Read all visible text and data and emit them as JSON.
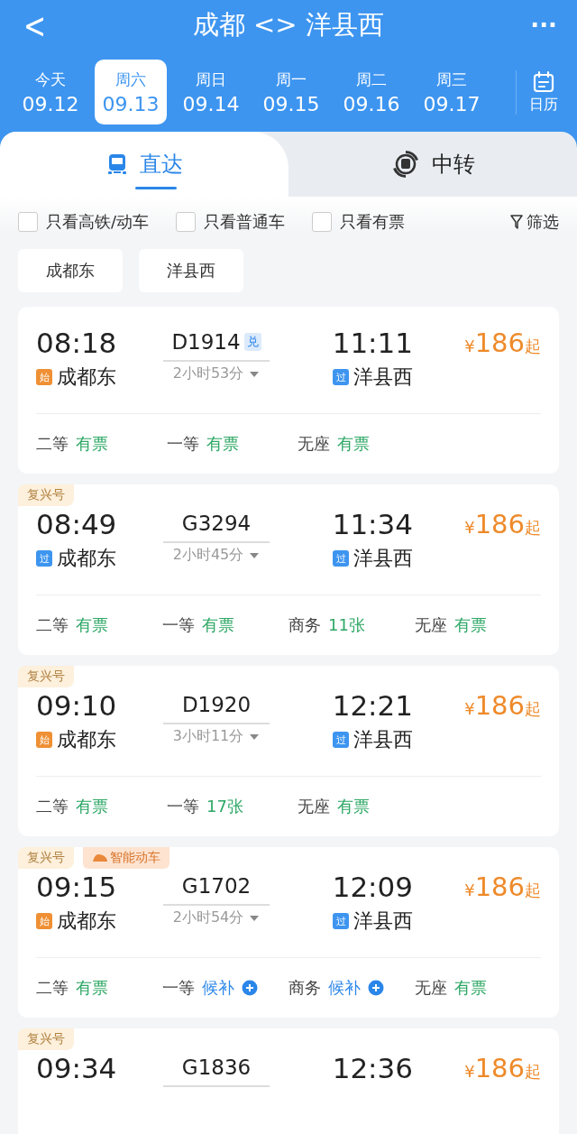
{
  "header": {
    "back": "<",
    "title": "成都 <> 洋县西",
    "more": "···"
  },
  "dates": [
    {
      "day": "今天",
      "date": "09.12",
      "selected": false
    },
    {
      "day": "周六",
      "date": "09.13",
      "selected": true
    },
    {
      "day": "周日",
      "date": "09.14",
      "selected": false
    },
    {
      "day": "周一",
      "date": "09.15",
      "selected": false
    },
    {
      "day": "周二",
      "date": "09.16",
      "selected": false
    },
    {
      "day": "周三",
      "date": "09.17",
      "selected": false
    }
  ],
  "calendar": {
    "label": "日历"
  },
  "tabs": [
    {
      "label": "直达",
      "selected": true
    },
    {
      "label": "中转",
      "selected": false
    }
  ],
  "filters": [
    {
      "label": "只看高铁/动车",
      "checked": false
    },
    {
      "label": "只看普通车",
      "checked": false
    },
    {
      "label": "只看有票",
      "checked": false
    }
  ],
  "filter_button": "筛选",
  "stations": [
    "成都东",
    "洋县西"
  ],
  "trains": [
    {
      "depart": "08:18",
      "train": "D1914",
      "exchange": "兑",
      "arrive": "11:11",
      "from_mark": {
        "text": "始",
        "kind": "start"
      },
      "from": "成都东",
      "duration": "2小时53分",
      "to_mark": {
        "text": "过",
        "kind": "pass"
      },
      "to": "洋县西",
      "price_symbol": "¥",
      "price": "186",
      "price_suffix": "起",
      "seats": [
        {
          "class": "二等",
          "status": "有票",
          "kind": "available"
        },
        {
          "class": "一等",
          "status": "有票",
          "kind": "available"
        },
        {
          "class": "无座",
          "status": "有票",
          "kind": "available"
        }
      ]
    },
    {
      "tags": [
        {
          "text": "复兴号",
          "kind": "plain"
        }
      ],
      "depart": "08:49",
      "train": "G3294",
      "arrive": "11:34",
      "from_mark": {
        "text": "过",
        "kind": "pass"
      },
      "from": "成都东",
      "duration": "2小时45分",
      "to_mark": {
        "text": "过",
        "kind": "pass"
      },
      "to": "洋县西",
      "price_symbol": "¥",
      "price": "186",
      "price_suffix": "起",
      "seats": [
        {
          "class": "二等",
          "status": "有票",
          "kind": "available"
        },
        {
          "class": "一等",
          "status": "有票",
          "kind": "available"
        },
        {
          "class": "商务",
          "status": "11张",
          "kind": "available"
        },
        {
          "class": "无座",
          "status": "有票",
          "kind": "available"
        }
      ]
    },
    {
      "tags": [
        {
          "text": "复兴号",
          "kind": "plain"
        }
      ],
      "depart": "09:10",
      "train": "D1920",
      "arrive": "12:21",
      "from_mark": {
        "text": "始",
        "kind": "start"
      },
      "from": "成都东",
      "duration": "3小时11分",
      "to_mark": {
        "text": "过",
        "kind": "pass"
      },
      "to": "洋县西",
      "price_symbol": "¥",
      "price": "186",
      "price_suffix": "起",
      "seats": [
        {
          "class": "二等",
          "status": "有票",
          "kind": "available"
        },
        {
          "class": "一等",
          "status": "17张",
          "kind": "available"
        },
        {
          "class": "无座",
          "status": "有票",
          "kind": "available"
        }
      ]
    },
    {
      "tags": [
        {
          "text": "复兴号",
          "kind": "plain"
        },
        {
          "text": "智能动车",
          "kind": "smart"
        }
      ],
      "depart": "09:15",
      "train": "G1702",
      "arrive": "12:09",
      "from_mark": {
        "text": "始",
        "kind": "start"
      },
      "from": "成都东",
      "duration": "2小时54分",
      "to_mark": {
        "text": "过",
        "kind": "pass"
      },
      "to": "洋县西",
      "price_symbol": "¥",
      "price": "186",
      "price_suffix": "起",
      "seats": [
        {
          "class": "二等",
          "status": "有票",
          "kind": "available"
        },
        {
          "class": "一等",
          "status": "候补",
          "kind": "waitlist"
        },
        {
          "class": "商务",
          "status": "候补",
          "kind": "waitlist"
        },
        {
          "class": "无座",
          "status": "有票",
          "kind": "available"
        }
      ]
    },
    {
      "tags": [
        {
          "text": "复兴号",
          "kind": "plain"
        }
      ],
      "depart": "09:34",
      "train": "G1836",
      "arrive": "12:36",
      "price_symbol": "¥",
      "price": "186",
      "price_suffix": "起"
    }
  ]
}
